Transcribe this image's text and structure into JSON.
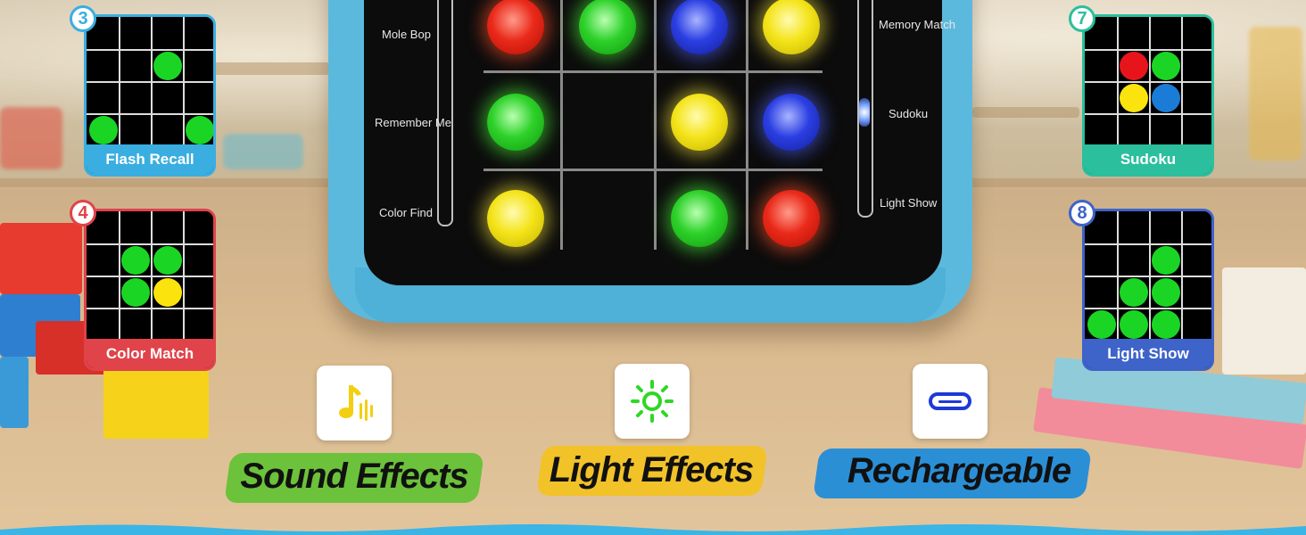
{
  "device": {
    "left_modes": [
      "Mole Bop",
      "Remember Me",
      "Color Find"
    ],
    "right_modes": [
      "Memory Match",
      "Sudoku",
      "Light Show"
    ],
    "lights": [
      [
        "red",
        "green",
        "blue",
        "yellow"
      ],
      [
        "green",
        "",
        "yellow",
        "blue"
      ],
      [
        "yellow",
        "",
        "green",
        "red"
      ]
    ]
  },
  "game_modes": [
    {
      "number": "3",
      "name": "Flash Recall",
      "color": "#3aaee0",
      "dots": [
        {
          "r": 1,
          "c": 2,
          "color": "green"
        },
        {
          "r": 3,
          "c": 0,
          "color": "green"
        },
        {
          "r": 3,
          "c": 3,
          "color": "green"
        }
      ]
    },
    {
      "number": "4",
      "name": "Color Match",
      "color": "#e0434a",
      "dots": [
        {
          "r": 1,
          "c": 1,
          "color": "green"
        },
        {
          "r": 1,
          "c": 2,
          "color": "green"
        },
        {
          "r": 2,
          "c": 1,
          "color": "green"
        },
        {
          "r": 2,
          "c": 2,
          "color": "yellow"
        }
      ]
    },
    {
      "number": "7",
      "name": "Sudoku",
      "color": "#2bbf9e",
      "dots": [
        {
          "r": 1,
          "c": 1,
          "color": "red"
        },
        {
          "r": 1,
          "c": 2,
          "color": "green"
        },
        {
          "r": 2,
          "c": 1,
          "color": "yellow"
        },
        {
          "r": 2,
          "c": 2,
          "color": "blue"
        }
      ]
    },
    {
      "number": "8",
      "name": "Light Show",
      "color": "#3e63c9",
      "dots": [
        {
          "r": 1,
          "c": 2,
          "color": "green"
        },
        {
          "r": 2,
          "c": 1,
          "color": "green"
        },
        {
          "r": 2,
          "c": 2,
          "color": "green"
        },
        {
          "r": 3,
          "c": 0,
          "color": "green"
        },
        {
          "r": 3,
          "c": 1,
          "color": "green"
        },
        {
          "r": 3,
          "c": 2,
          "color": "green"
        }
      ]
    }
  ],
  "features": [
    {
      "label": "Sound Effects",
      "icon": "music-note-icon",
      "brush_color": "#6cc23a"
    },
    {
      "label": "Light Effects",
      "icon": "sun-icon",
      "brush_color": "#f2c229"
    },
    {
      "label": "Rechargeable",
      "icon": "usb-c-icon",
      "brush_color": "#2b8fd6"
    }
  ]
}
